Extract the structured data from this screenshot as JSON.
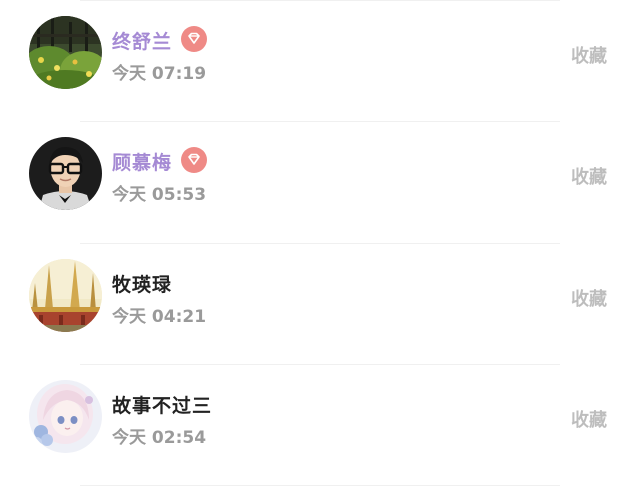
{
  "messages": [
    {
      "name": "终舒兰",
      "vip": true,
      "time": "今天 07:19",
      "action": "收藏",
      "avatar_icon": "garden-photo-avatar",
      "badge_icon": "diamond-icon"
    },
    {
      "name": "顾慕梅",
      "vip": true,
      "time": "今天 05:53",
      "action": "收藏",
      "avatar_icon": "man-with-glasses-avatar",
      "badge_icon": "diamond-icon"
    },
    {
      "name": "牧瑛琭",
      "vip": false,
      "time": "今天 04:21",
      "action": "收藏",
      "avatar_icon": "temple-photo-avatar"
    },
    {
      "name": "故事不过三",
      "vip": false,
      "time": "今天 02:54",
      "action": "收藏",
      "avatar_icon": "anime-girl-avatar"
    }
  ],
  "colors": {
    "vip_name": "#a58ad4",
    "badge": "#ef8a86",
    "time": "#9a9a9a",
    "action": "#bdbdbd"
  }
}
